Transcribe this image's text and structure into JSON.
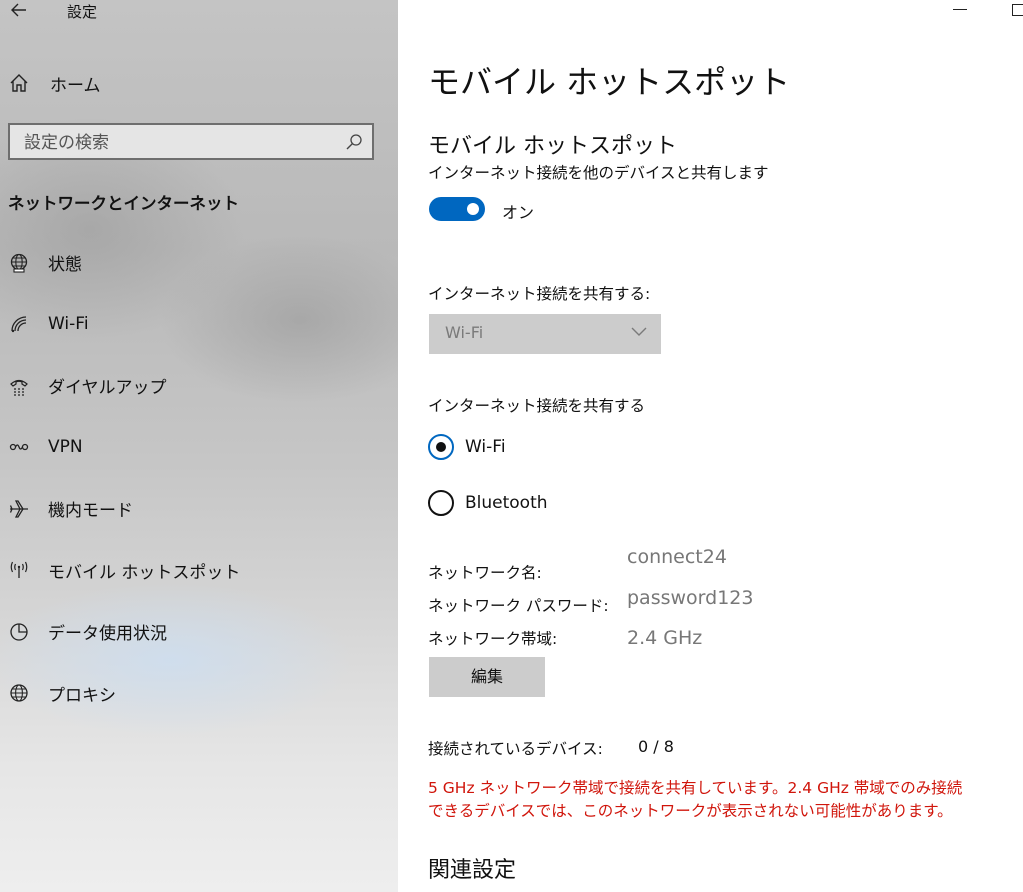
{
  "window": {
    "title": "設定"
  },
  "sidebar": {
    "home_label": "ホーム",
    "search_placeholder": "設定の検索",
    "section_title": "ネットワークとインターネット",
    "items": [
      {
        "label": "状態",
        "icon": "globe-status-icon"
      },
      {
        "label": "Wi-Fi",
        "icon": "wifi-icon"
      },
      {
        "label": "ダイヤルアップ",
        "icon": "dialup-icon"
      },
      {
        "label": "VPN",
        "icon": "vpn-icon"
      },
      {
        "label": "機内モード",
        "icon": "airplane-icon"
      },
      {
        "label": "モバイル ホットスポット",
        "icon": "hotspot-icon"
      },
      {
        "label": "データ使用状況",
        "icon": "data-usage-icon"
      },
      {
        "label": "プロキシ",
        "icon": "proxy-globe-icon"
      }
    ]
  },
  "main": {
    "page_title": "モバイル ホットスポット",
    "section_title": "モバイル ホットスポット",
    "description": "インターネット接続を他のデバイスと共有します",
    "toggle": {
      "state": "on",
      "label": "オン"
    },
    "share_from": {
      "label": "インターネット接続を共有する:",
      "selected": "Wi-Fi"
    },
    "share_over": {
      "label": "インターネット接続を共有する",
      "options": [
        {
          "label": "Wi-Fi",
          "checked": true
        },
        {
          "label": "Bluetooth",
          "checked": false
        }
      ]
    },
    "network_name": {
      "label": "ネットワーク名:",
      "value": "connect24"
    },
    "network_password": {
      "label": "ネットワーク パスワード:",
      "value": "password123"
    },
    "network_band": {
      "label": "ネットワーク帯域:",
      "value": "2.4 GHz"
    },
    "edit_button": "編集",
    "devices": {
      "label": "接続されているデバイス:",
      "value": "0 / 8"
    },
    "warning_line1": "5 GHz ネットワーク帯域で接続を共有しています。2.4 GHz 帯域でのみ接続",
    "warning_line2": "できるデバイスでは、このネットワークが表示されない可能性があります。",
    "related_settings": "関連設定"
  },
  "colors": {
    "accent": "#0067c0",
    "warning": "#d0150b",
    "disabled_value": "#777777"
  }
}
